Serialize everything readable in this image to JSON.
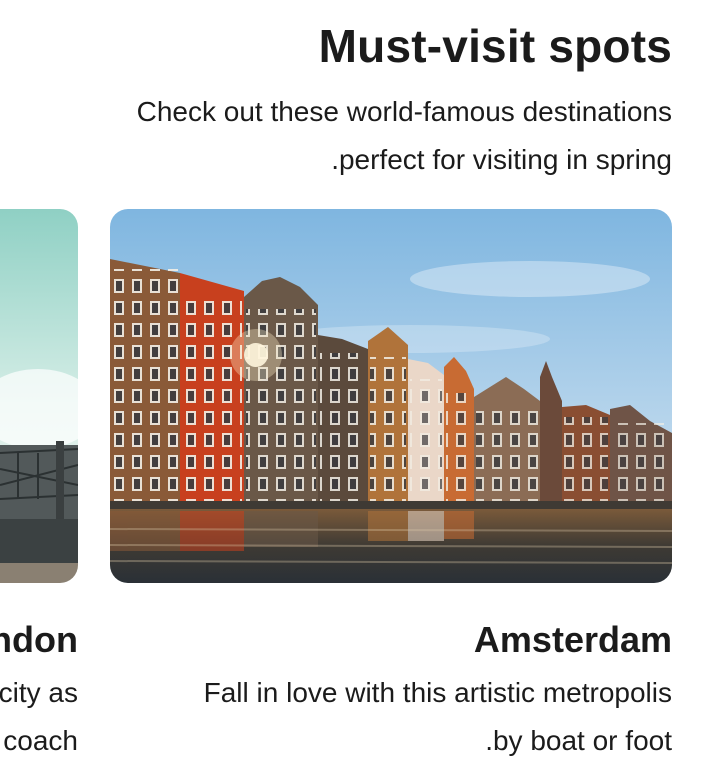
{
  "header": {
    "title": "Must-visit spots",
    "subtitle_line1": "Check out these world-famous destinations",
    "subtitle_line2": ".perfect for visiting in spring"
  },
  "destinations": [
    {
      "name": "London",
      "desc_line1": "Explore the city as",
      "desc_line2": "a local by coach"
    },
    {
      "name": "Amsterdam",
      "desc_line1": "Fall in love with this artistic metropolis",
      "desc_line2": ".by boat or foot"
    }
  ]
}
